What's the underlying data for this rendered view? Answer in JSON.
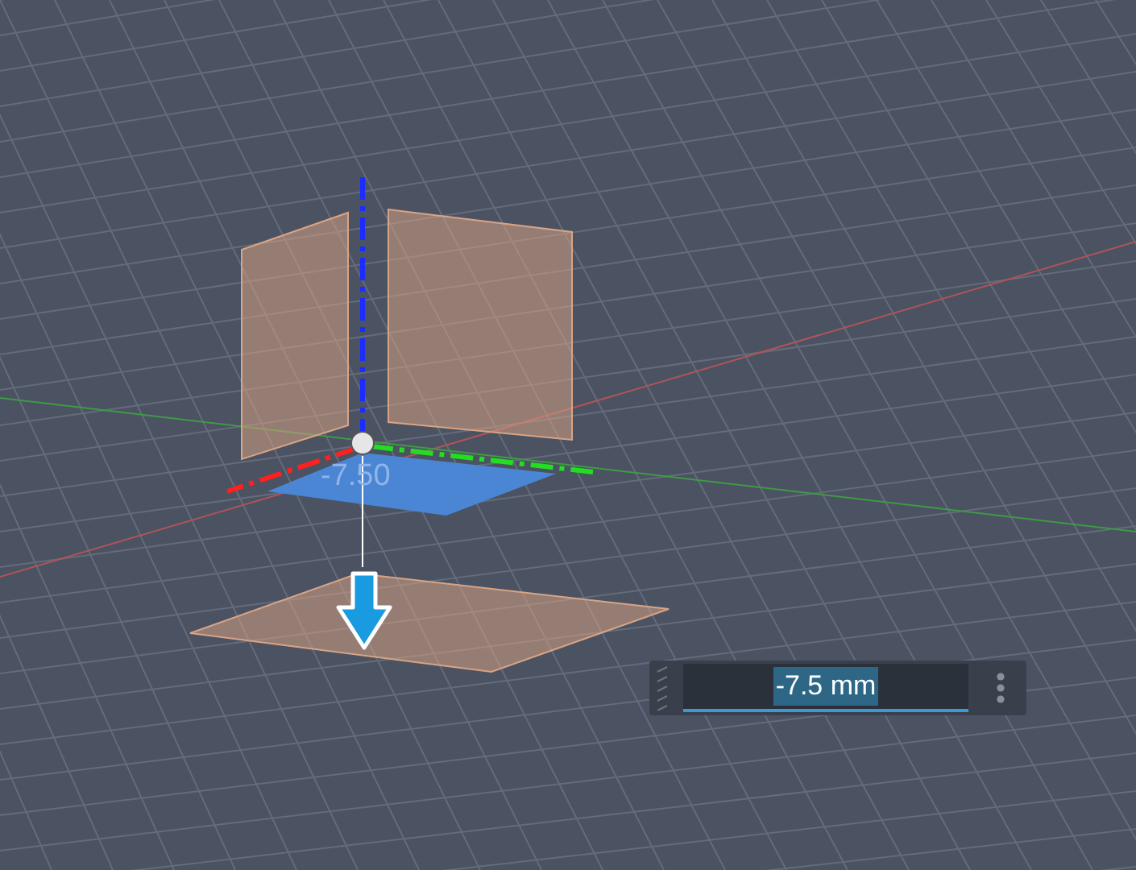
{
  "viewport": {
    "dimension_label": "-7.50"
  },
  "input_box": {
    "value": "-7.5 mm",
    "value_selected": true
  }
}
